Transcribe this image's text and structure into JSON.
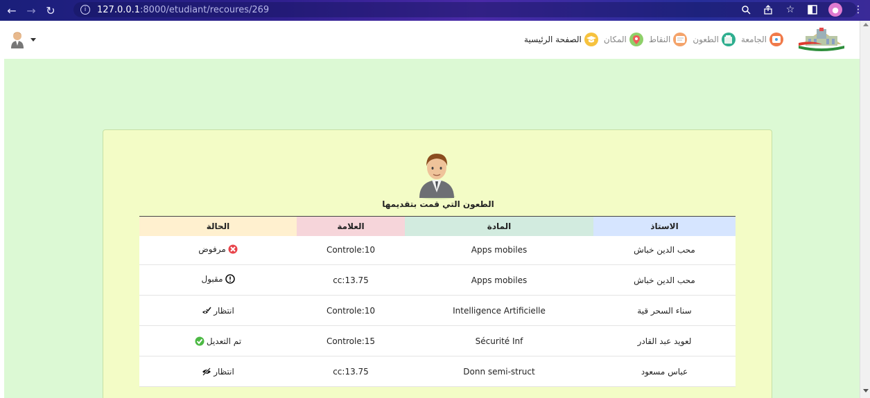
{
  "browser": {
    "url_host": "127.0.0.1",
    "url_path": ":8000/etudiant/recoures/269"
  },
  "nav": {
    "links": [
      {
        "label": "الصفحة الرئيسية",
        "icon": "graduation-cap-icon",
        "active": true
      },
      {
        "label": "المكان",
        "icon": "map-pin-icon",
        "active": false
      },
      {
        "label": "النقاط",
        "icon": "message-icon",
        "active": false
      },
      {
        "label": "الطعون",
        "icon": "folder-icon",
        "active": false
      },
      {
        "label": "الجامعة",
        "icon": "university-icon",
        "active": false
      }
    ]
  },
  "card": {
    "title": "الطعون التي قمت بتقديمها"
  },
  "table": {
    "headers": {
      "professor": "الاستاذ",
      "subject": "المادة",
      "mark": "العلامة",
      "status": "الحالة"
    },
    "rows": [
      {
        "professor": "محب الدين خباش",
        "subject": "Apps mobiles",
        "mark": "Controle:10",
        "status": "مرفوض",
        "status_icon": "rejected-x-icon"
      },
      {
        "professor": "محب الدين خباش",
        "subject": "Apps mobiles",
        "mark": "cc:13.75",
        "status": "مقبول",
        "status_icon": "exclamation-circle-icon"
      },
      {
        "professor": "سناء السحر قية",
        "subject": "Intelligence Artificielle",
        "mark": "Controle:10",
        "status": "انتظار",
        "status_icon": "eye-check-icon"
      },
      {
        "professor": "لعويد عبد القادر",
        "subject": "Sécurité Inf",
        "mark": "Controle:15",
        "status": "تم التعديل",
        "status_icon": "check-circle-icon"
      },
      {
        "professor": "عباس مسعود",
        "subject": "Donn semi-struct",
        "mark": "cc:13.75",
        "status": "انتظار",
        "status_icon": "eye-slash-icon"
      }
    ]
  },
  "colors": {
    "page_bg": "#dcf9d4",
    "card_bg": "#f3fcc6",
    "header_professor": "#d6e5ff",
    "header_subject": "#d2ebdf",
    "header_mark": "#f6d5da",
    "header_status": "#fff0cf"
  }
}
